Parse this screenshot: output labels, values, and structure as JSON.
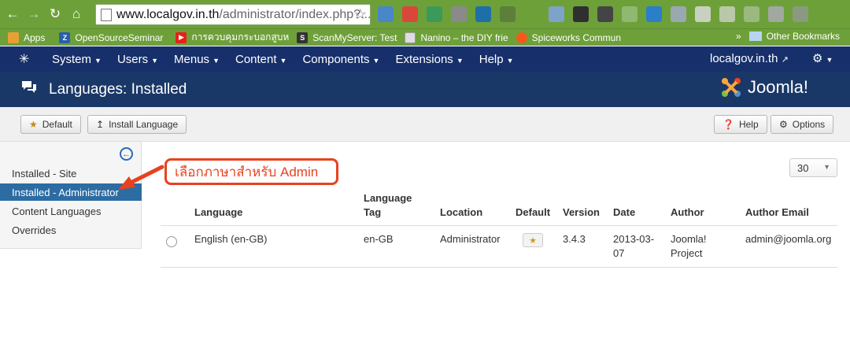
{
  "browser": {
    "url_domain": "www.localgov.in.th",
    "url_path": "/administrator/index.php?...",
    "bookmarks": [
      {
        "label": "Apps",
        "icon": "apps-grid-icon",
        "color": "#e8a032"
      },
      {
        "label": "OpenSourceSeminar",
        "icon": "z-icon",
        "color": "#2a5fa8"
      },
      {
        "label": "การควบคุมกระบอกสูบห",
        "icon": "youtube-icon",
        "color": "#e62117"
      },
      {
        "label": "ScanMyServer: Test",
        "icon": "scan-icon",
        "color": "#333333"
      },
      {
        "label": "Nanino – the DIY frie",
        "icon": "page-icon",
        "color": "#cccccc"
      },
      {
        "label": "Spiceworks Commun",
        "icon": "spiceworks-icon",
        "color": "#f25a1d"
      }
    ],
    "more": "»",
    "other_bookmarks": "Other Bookmarks"
  },
  "nav": {
    "menus": [
      "System",
      "Users",
      "Menus",
      "Content",
      "Components",
      "Extensions",
      "Help"
    ],
    "site_link": "localgov.in.th"
  },
  "header": {
    "title": "Languages: Installed",
    "brand": "Joomla!"
  },
  "toolbar": {
    "default_label": "Default",
    "install_label": "Install Language",
    "help_label": "Help",
    "options_label": "Options"
  },
  "sidebar": {
    "items": [
      {
        "label": "Installed - Site"
      },
      {
        "label": "Installed - Administrator"
      },
      {
        "label": "Content Languages"
      },
      {
        "label": "Overrides"
      }
    ]
  },
  "annotation": {
    "text": "เลือกภาษาสำหรับ Admin"
  },
  "list": {
    "limit": "30",
    "columns": {
      "language": "Language",
      "tag_line1": "Language",
      "tag_line2": "Tag",
      "location": "Location",
      "default": "Default",
      "version": "Version",
      "date": "Date",
      "author": "Author",
      "author_email": "Author Email"
    },
    "rows": [
      {
        "language": "English (en-GB)",
        "tag": "en-GB",
        "location": "Administrator",
        "version": "3.4.3",
        "date_line1": "2013-03-",
        "date_line2": "07",
        "author_line1": "Joomla!",
        "author_line2": "Project",
        "author_email": "admin@joomla.org"
      }
    ]
  },
  "colors": {
    "browser_green": "#6ea03a",
    "navbar": "#17306b",
    "header": "#1a3867",
    "sidebar_active": "#2d6ca2",
    "annotation": "#e7421f"
  }
}
